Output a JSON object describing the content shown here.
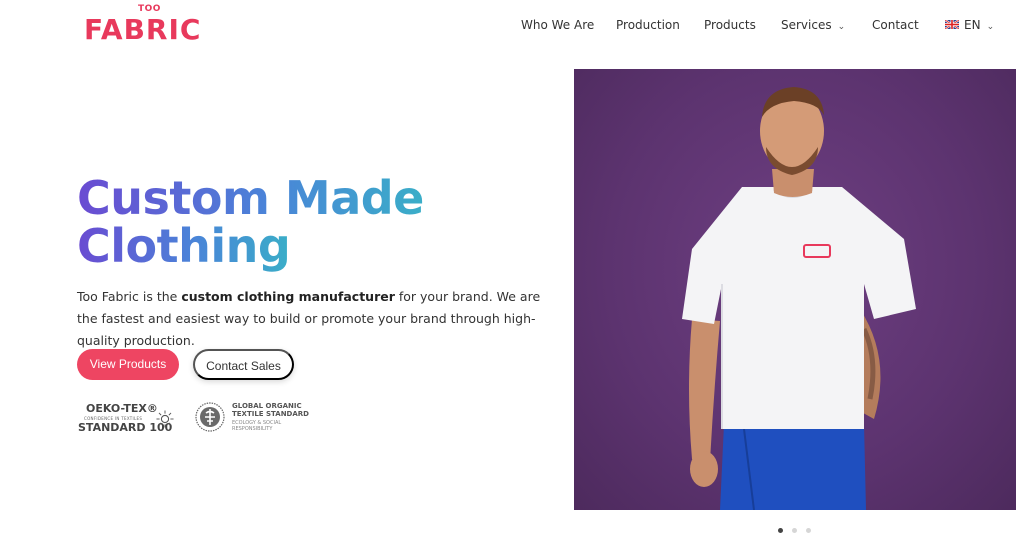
{
  "brand": {
    "logo_small": "TOO",
    "logo_main": "FABRIC",
    "accent_color": "#e8395c",
    "primary_button_color": "#ee4562"
  },
  "nav": {
    "items": [
      {
        "label": "Who We Are",
        "has_dropdown": false
      },
      {
        "label": "Production",
        "has_dropdown": false
      },
      {
        "label": "Products",
        "has_dropdown": false
      },
      {
        "label": "Services",
        "has_dropdown": true
      },
      {
        "label": "Contact",
        "has_dropdown": false
      }
    ],
    "language": {
      "label": "EN",
      "flag": "uk-flag-icon",
      "has_dropdown": true
    }
  },
  "hero": {
    "title_line1": "Custom Made",
    "title_line2": "Clothing",
    "desc_prefix": "Too Fabric is the ",
    "desc_bold": "custom clothing manufacturer",
    "desc_suffix": " for your brand. We are the fastest and easiest way to build or promote your brand through high-quality production.",
    "primary_button": "View Products",
    "secondary_button": "Contact Sales",
    "image_alt": "Man wearing white t-shirt and blue shorts",
    "image_background": "#5c336f"
  },
  "certifications": {
    "oeko": {
      "line1": "OEKO-TEX®",
      "line2": "CONFIDENCE IN TEXTILES",
      "line3": "STANDARD 100"
    },
    "gots": {
      "line1": "GLOBAL ORGANIC",
      "line2": "TEXTILE STANDARD",
      "line3": "ECOLOGY & SOCIAL",
      "line4": "RESPONSIBILITY"
    }
  },
  "carousel": {
    "slide_count": 3,
    "active_index": 0
  }
}
